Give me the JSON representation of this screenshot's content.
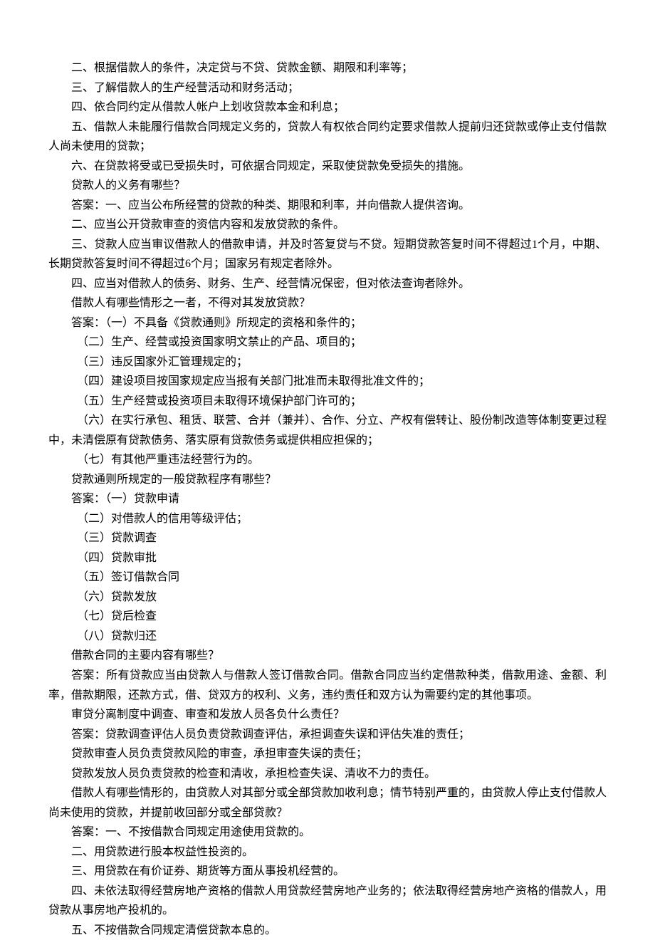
{
  "lines": [
    {
      "class": "para",
      "text": "二、根据借款人的条件，决定贷与不贷、贷款金额、期限和利率等；"
    },
    {
      "class": "para",
      "text": "三、了解借款人的生产经营活动和财务活动；"
    },
    {
      "class": "para",
      "text": "四、依合同约定从借款人帐户上划收贷款本金和利息；"
    },
    {
      "class": "para",
      "text": "五、借款人未能履行借款合同规定义务的，贷款人有权依合同约定要求借款人提前归还贷款或停止支付借款人尚未使用的贷款；"
    },
    {
      "class": "para",
      "text": "六、在贷款将受或已受损失时，可依据合同规定，采取使贷款免受损失的措施。"
    },
    {
      "class": "para",
      "text": "贷款人的义务有哪些？"
    },
    {
      "class": "para",
      "text": "答案：一、应当公布所经营的贷款的种类、期限和利率，并向借款人提供咨询。"
    },
    {
      "class": "para",
      "text": "二、应当公开贷款审查的资信内容和发放贷款的条件。"
    },
    {
      "class": "para",
      "text": "三、贷款人应当审议借款人的借款申请，并及时答复贷与不贷。短期贷款答复时间不得超过1个月，中期、长期贷款答复时间不得超过6个月；国家另有规定者除外。"
    },
    {
      "class": "para",
      "text": "四、应当对借款人的债务、财务、生产、经营情况保密，但对依法查询者除外。"
    },
    {
      "class": "para",
      "text": "借款人有哪些情形之一者，不得对其发放贷款？"
    },
    {
      "class": "para",
      "text": "答案：（一）不具备《贷款通则》所规定的资格和条件的；"
    },
    {
      "class": "para",
      "text": "　（二）生产、经营或投资国家明文禁止的产品、项目的；"
    },
    {
      "class": "para",
      "text": "　（三）违反国家外汇管理规定的；"
    },
    {
      "class": "para",
      "text": "　（四）建设项目按国家规定应当报有关部门批准而未取得批准文件的；"
    },
    {
      "class": "para",
      "text": "　（五）生产经营或投资项目未取得环境保护部门许可的；"
    },
    {
      "class": "para",
      "text": "　（六）在实行承包、租赁、联营、合并（兼并）、合作、分立、产权有偿转让、股份制改造等体制变更过程中，未清偿原有贷款债务、落实原有贷款债务或提供相应担保的；"
    },
    {
      "class": "para",
      "text": "　（七）有其他严重违法经营行为的。"
    },
    {
      "class": "para",
      "text": "贷款通则所规定的一般贷款程序有哪些？"
    },
    {
      "class": "para",
      "text": "答案：（一）贷款申请"
    },
    {
      "class": "para",
      "text": "　（二）对借款人的信用等级评估；"
    },
    {
      "class": "para",
      "text": "　（三）贷款调查"
    },
    {
      "class": "para",
      "text": "　（四）贷款审批"
    },
    {
      "class": "para",
      "text": "　（五）签订借款合同"
    },
    {
      "class": "para",
      "text": "　（六）贷款发放"
    },
    {
      "class": "para",
      "text": "　（七）贷后检查"
    },
    {
      "class": "para",
      "text": "　（八）贷款归还"
    },
    {
      "class": "para",
      "text": "借款合同的主要内容有哪些？"
    },
    {
      "class": "para",
      "text": "答案：所有贷款应当由贷款人与借款人签订借款合同。借款合同应当约定借款种类，借款用途、金额、利率，借款期限，还款方式，借、贷双方的权利、义务，违约责任和双方认为需要约定的其他事项。"
    },
    {
      "class": "para",
      "text": "审贷分离制度中调查、审查和发放人员各负什么责任？"
    },
    {
      "class": "para",
      "text": "答案：贷款调查评估人员负责贷款调查评估，承担调查失误和评估失准的责任；"
    },
    {
      "class": "para",
      "text": "贷款审查人员负责贷款风险的审查，承担审查失误的责任；"
    },
    {
      "class": "para",
      "text": "贷款发放人员负责贷款的检查和清收，承担检查失误、清收不力的责任。"
    },
    {
      "class": "para",
      "text": "借款人有哪些情形的，由贷款人对其部分或全部贷款加收利息；情节特别严重的，由贷款人停止支付借款人尚未使用的贷款，并提前收回部分或全部贷款？"
    },
    {
      "class": "para",
      "text": "答案：一、不按借款合同规定用途使用贷款的。"
    },
    {
      "class": "para",
      "text": "二、用贷款进行股本权益性投资的。"
    },
    {
      "class": "para",
      "text": "三、用贷款在有价证券、期货等方面从事投机经营的。"
    },
    {
      "class": "para",
      "text": "四、未依法取得经营房地产资格的借款人用贷款经营房地产业务的；依法取得经营房地产资格的借款人，用贷款从事房地产投机的。"
    },
    {
      "class": "para",
      "text": "五、不按借款合同规定清偿贷款本息的。"
    }
  ]
}
